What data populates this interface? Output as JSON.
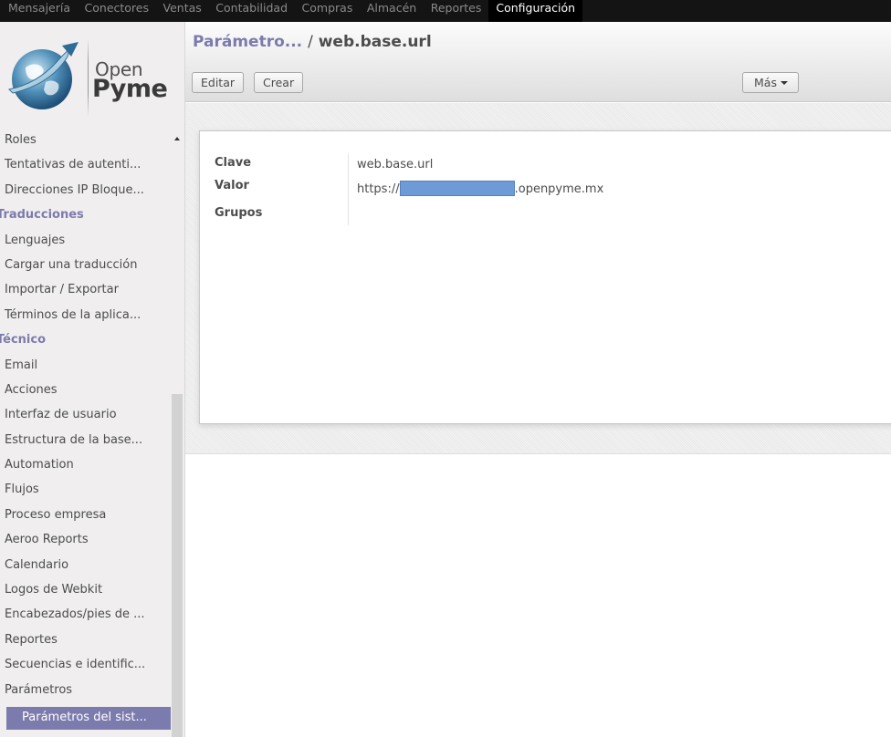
{
  "topbar": {
    "items": [
      "Mensajería",
      "Conectores",
      "Ventas",
      "Contabilidad",
      "Compras",
      "Almacén",
      "Reportes",
      "Configuración"
    ],
    "active": "Configuración"
  },
  "logo": {
    "line1": "Open",
    "line2": "Pyme"
  },
  "sidebar": {
    "items": [
      {
        "label": "Roles",
        "type": "item"
      },
      {
        "label": "Tentativas de autenti...",
        "type": "item"
      },
      {
        "label": "Direcciones IP Bloque...",
        "type": "item"
      },
      {
        "label": "Traducciones",
        "type": "section"
      },
      {
        "label": "Lenguajes",
        "type": "item"
      },
      {
        "label": "Cargar una traducción",
        "type": "item"
      },
      {
        "label": "Importar / Exportar",
        "type": "item"
      },
      {
        "label": "Términos de la aplica...",
        "type": "item"
      },
      {
        "label": "Técnico",
        "type": "section"
      },
      {
        "label": "Email",
        "type": "item"
      },
      {
        "label": "Acciones",
        "type": "item"
      },
      {
        "label": "Interfaz de usuario",
        "type": "item"
      },
      {
        "label": "Estructura de la base...",
        "type": "item"
      },
      {
        "label": "Automation",
        "type": "item"
      },
      {
        "label": "Flujos",
        "type": "item"
      },
      {
        "label": "Proceso empresa",
        "type": "item"
      },
      {
        "label": "Aeroo Reports",
        "type": "item"
      },
      {
        "label": "Calendario",
        "type": "item"
      },
      {
        "label": "Logos de Webkit",
        "type": "item"
      },
      {
        "label": "Encabezados/pies de ...",
        "type": "item"
      },
      {
        "label": "Reportes",
        "type": "item"
      },
      {
        "label": "Secuencias e identific...",
        "type": "item"
      },
      {
        "label": "Parámetros",
        "type": "item"
      },
      {
        "label": "Parámetros del sist...",
        "type": "selected"
      }
    ]
  },
  "header": {
    "breadcrumb_parent": "Parámetro...",
    "breadcrumb_separator": "/",
    "breadcrumb_current": "web.base.url",
    "edit_label": "Editar",
    "create_label": "Crear",
    "more_label": "Más"
  },
  "form": {
    "key_label": "Clave",
    "key_value": "web.base.url",
    "value_label": "Valor",
    "value_prefix": "https://",
    "value_suffix": ".openpyme.mx",
    "groups_label": "Grupos"
  },
  "colors": {
    "accent": "#7c7bad",
    "topbar_bg": "#141414",
    "sidebar_bg": "#f0eeee",
    "redaction": "#6e9bd6"
  }
}
